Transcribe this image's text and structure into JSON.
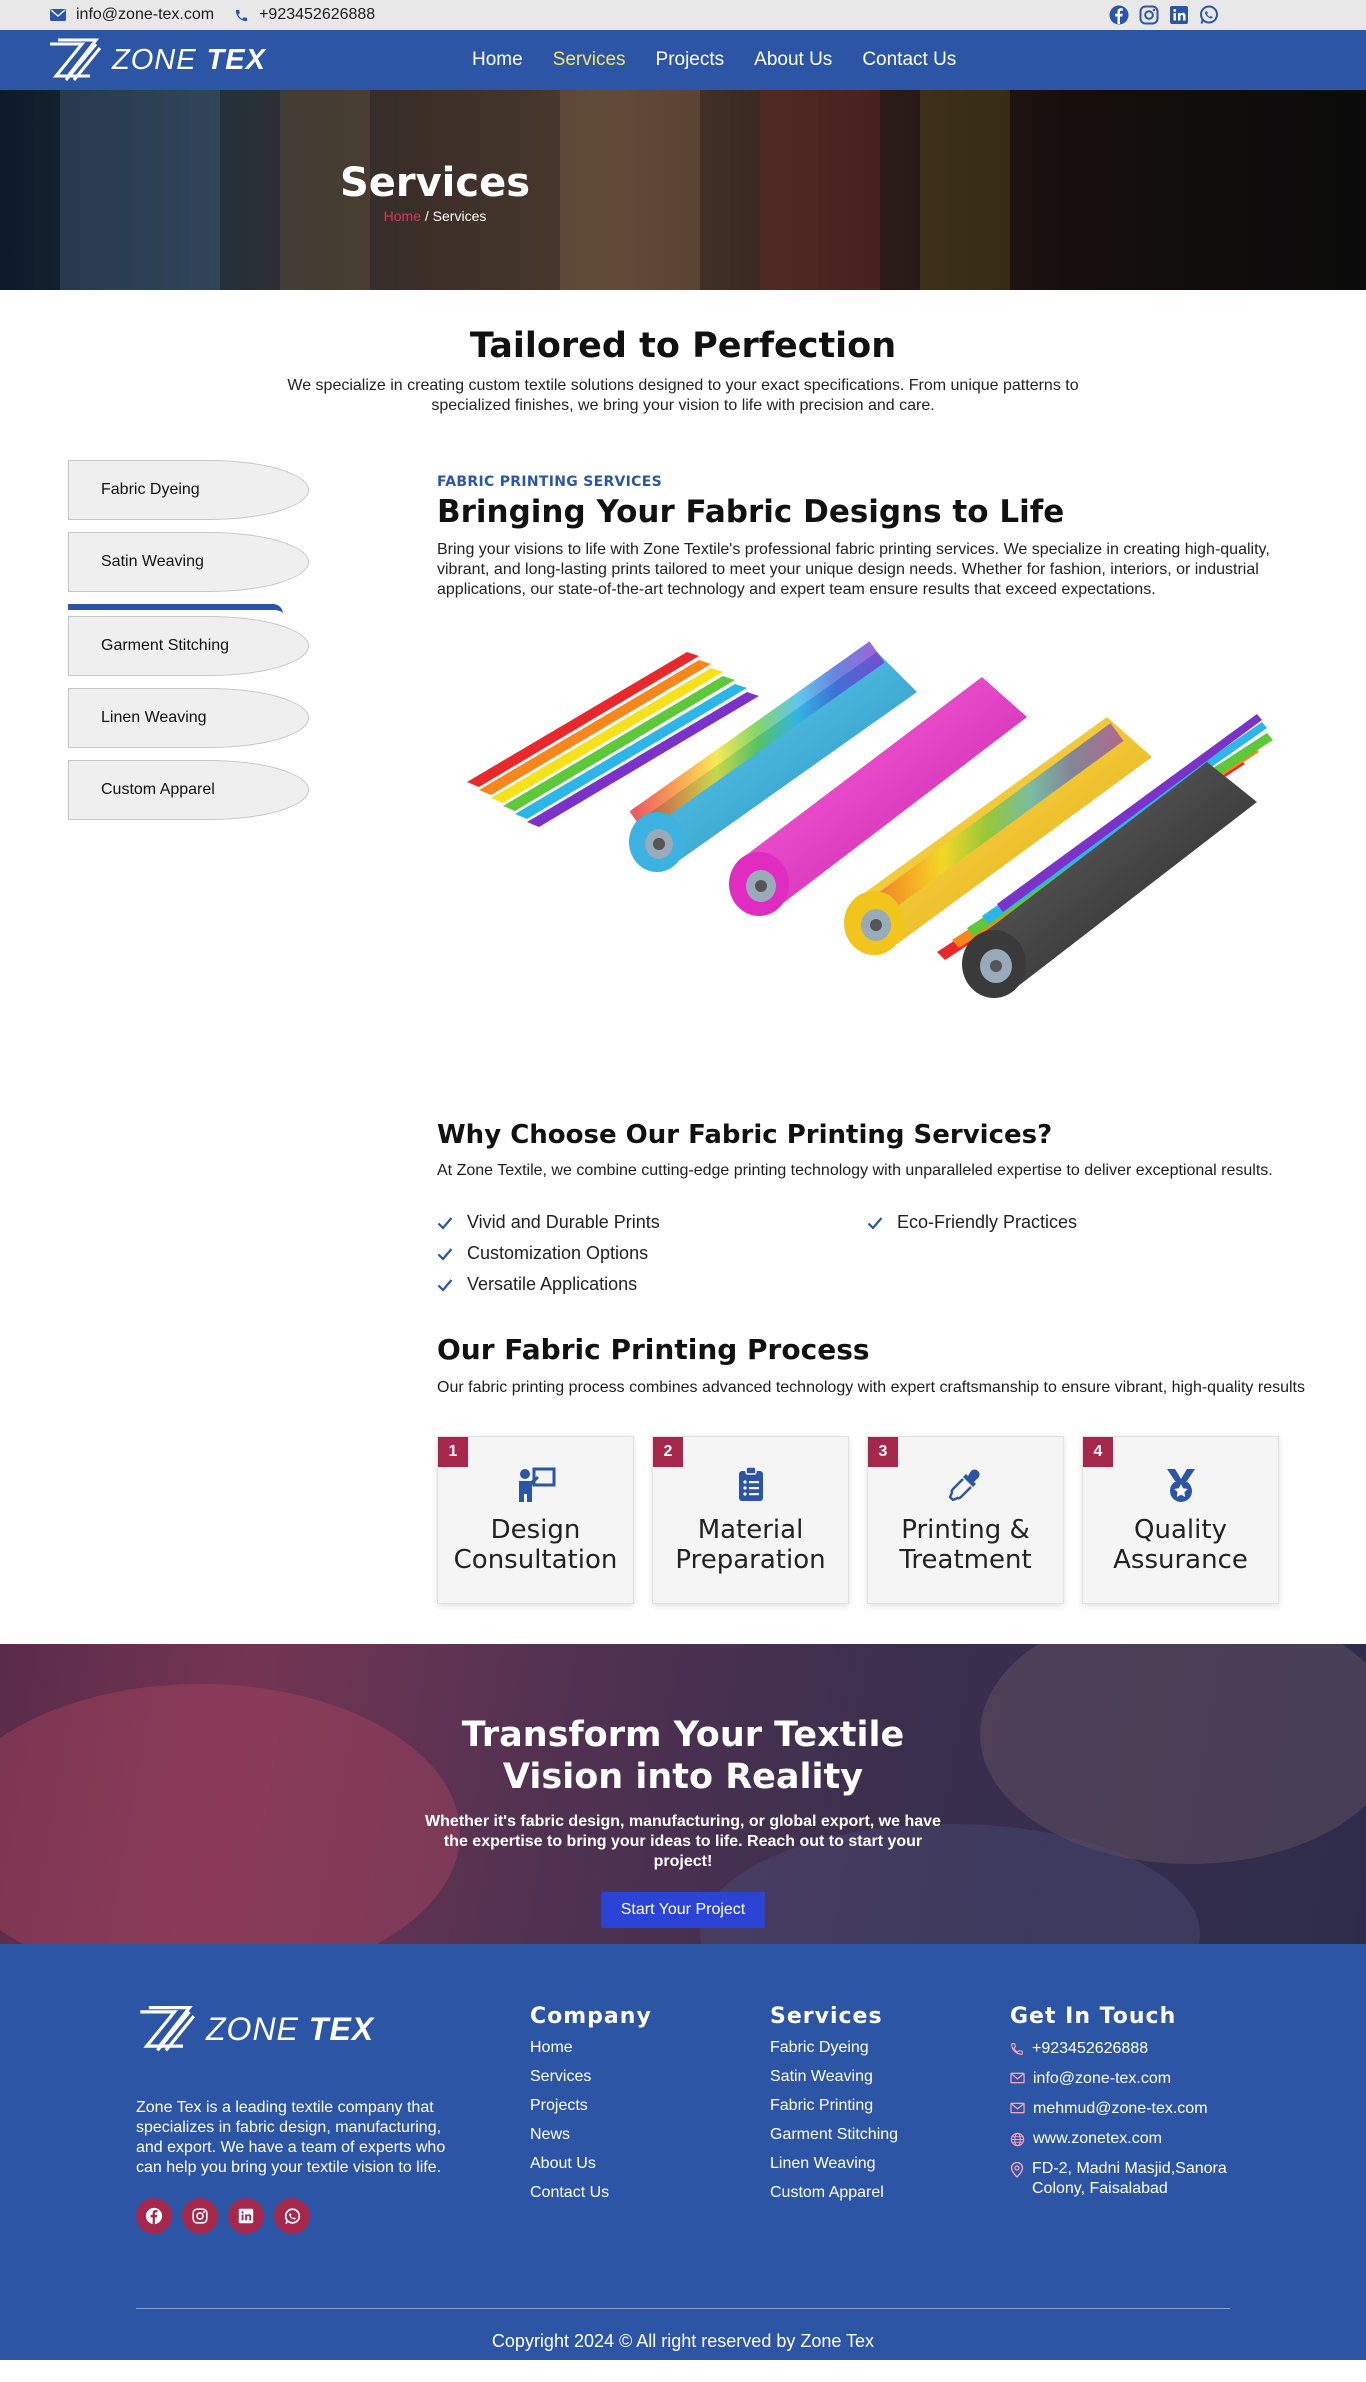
{
  "topbar": {
    "email": "info@zone-tex.com",
    "phone": "+923452626888",
    "social": [
      "facebook-icon",
      "instagram-icon",
      "linkedin-icon",
      "whatsapp-icon"
    ]
  },
  "brand": {
    "name_thin": "ZONE",
    "name_bold": "TEX"
  },
  "nav": {
    "items": [
      "Home",
      "Services",
      "Projects",
      "About Us",
      "Contact Us"
    ],
    "active": "Services"
  },
  "hero": {
    "title": "Services",
    "crumb_home": "Home",
    "crumb_sep": " / ",
    "crumb_current": "Services"
  },
  "intro": {
    "title": "Tailored to Perfection",
    "text": "We specialize in creating custom textile solutions designed to your exact specifications. From unique patterns to specialized finishes, we bring your vision to life with precision and care."
  },
  "sidebar": {
    "items": [
      "Fabric Dyeing",
      "Satin Weaving",
      "Garment Stitching",
      "Linen Weaving",
      "Custom Apparel"
    ]
  },
  "service": {
    "eyebrow": "FABRIC PRINTING SERVICES",
    "title": "Bringing Your Fabric Designs to Life",
    "text": "Bring your visions to life with Zone Textile's professional fabric printing services. We specialize in creating high-quality, vibrant, and long-lasting prints tailored to meet your unique design needs. Whether for fashion, interiors, or industrial applications, our state-of-the-art technology and expert team ensure results that exceed expectations."
  },
  "why": {
    "title": "Why Choose Our Fabric Printing Services?",
    "text": "At Zone Textile, we combine cutting-edge printing technology with unparalleled expertise to deliver exceptional results.",
    "points": [
      "Vivid and Durable Prints",
      "Eco-Friendly Practices",
      "Customization Options",
      "Versatile Applications"
    ]
  },
  "process": {
    "title": "Our Fabric Printing Process",
    "text": "Our fabric printing process combines advanced technology with expert craftsmanship to ensure vibrant, high-quality results",
    "steps": [
      {
        "num": "1",
        "label": "Design Consultation",
        "icon": "presentation-icon"
      },
      {
        "num": "2",
        "label": "Material Preparation",
        "icon": "clipboard-list-icon"
      },
      {
        "num": "3",
        "label": "Printing & Treatment",
        "icon": "eyedropper-icon"
      },
      {
        "num": "4",
        "label": "Quality Assurance",
        "icon": "medal-icon"
      }
    ]
  },
  "cta": {
    "title": "Transform Your Textile Vision into Reality",
    "text": "Whether it's fabric design, manufacturing, or global export, we have the expertise to bring your ideas to life. Reach out to start your project!",
    "button": "Start Your Project"
  },
  "footer": {
    "about": "Zone Tex is a leading textile company that specializes in fabric design, manufacturing, and export. We have a team of experts who can help you bring your textile vision to life.",
    "company_title": "Company",
    "company_links": [
      "Home",
      "Services",
      "Projects",
      "News",
      "About Us",
      "Contact Us"
    ],
    "services_title": "Services",
    "services_links": [
      "Fabric Dyeing",
      "Satin Weaving",
      "Fabric Printing",
      "Garment Stitching",
      "Linen Weaving",
      "Custom Apparel"
    ],
    "touch_title": "Get In Touch",
    "phone": "+923452626888",
    "email1": "info@zone-tex.com",
    "email2": "mehmud@zone-tex.com",
    "website": "www.zonetex.com",
    "address": "FD-2, Madni Masjid,Sanora Colony, Faisalabad",
    "copyright": "Copyright 2024 © All right reserved by Zone Tex"
  },
  "colors": {
    "brand_blue": "#2c55a6",
    "accent_red": "#a5284c",
    "nav_active": "#f4e26b"
  }
}
